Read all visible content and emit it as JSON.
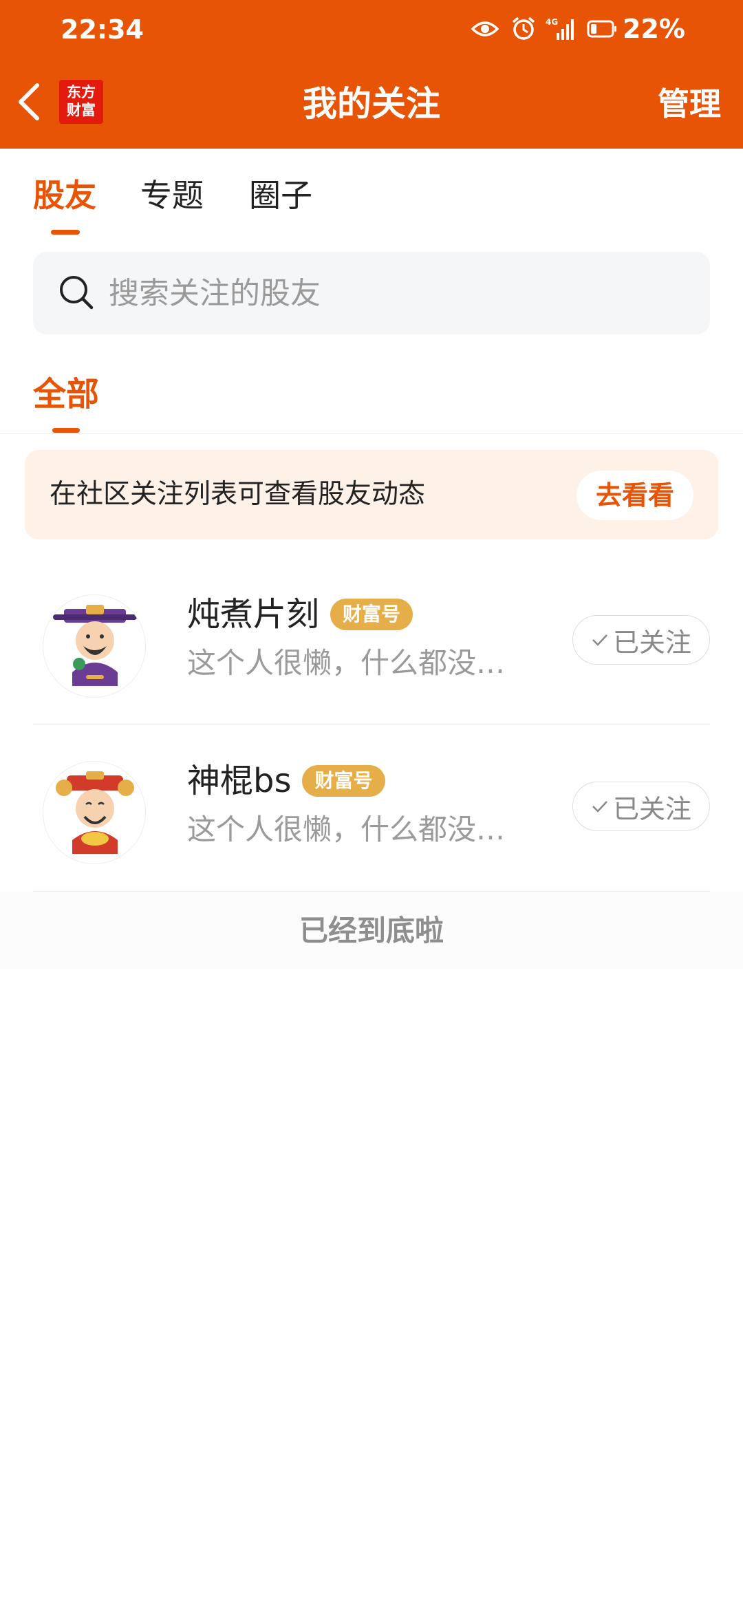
{
  "status_bar": {
    "time": "22:34",
    "network": "4G",
    "battery": "22%"
  },
  "nav": {
    "logo_line1": "东方",
    "logo_line2": "财富",
    "title": "我的关注",
    "manage": "管理"
  },
  "tabs": [
    {
      "label": "股友",
      "active": true
    },
    {
      "label": "专题",
      "active": false
    },
    {
      "label": "圈子",
      "active": false
    }
  ],
  "search": {
    "placeholder": "搜索关注的股友",
    "value": ""
  },
  "subtab": {
    "label": "全部"
  },
  "banner": {
    "text": "在社区关注列表可查看股友动态",
    "button": "去看看"
  },
  "follows": [
    {
      "name": "炖煮片刻",
      "badge": "财富号",
      "bio": "这个人很懒，什么都没…",
      "button": "已关注",
      "avatar": "god-of-wealth-purple-avatar"
    },
    {
      "name": "神棍bs",
      "badge": "财富号",
      "bio": "这个人很懒，什么都没…",
      "button": "已关注",
      "avatar": "god-of-wealth-red-avatar"
    }
  ],
  "footer": {
    "end_text": "已经到底啦"
  },
  "colors": {
    "brand": "#E85405",
    "badge": "#E6AE48",
    "banner_bg": "#FEF1E8",
    "muted_text": "#9A9A9A"
  }
}
